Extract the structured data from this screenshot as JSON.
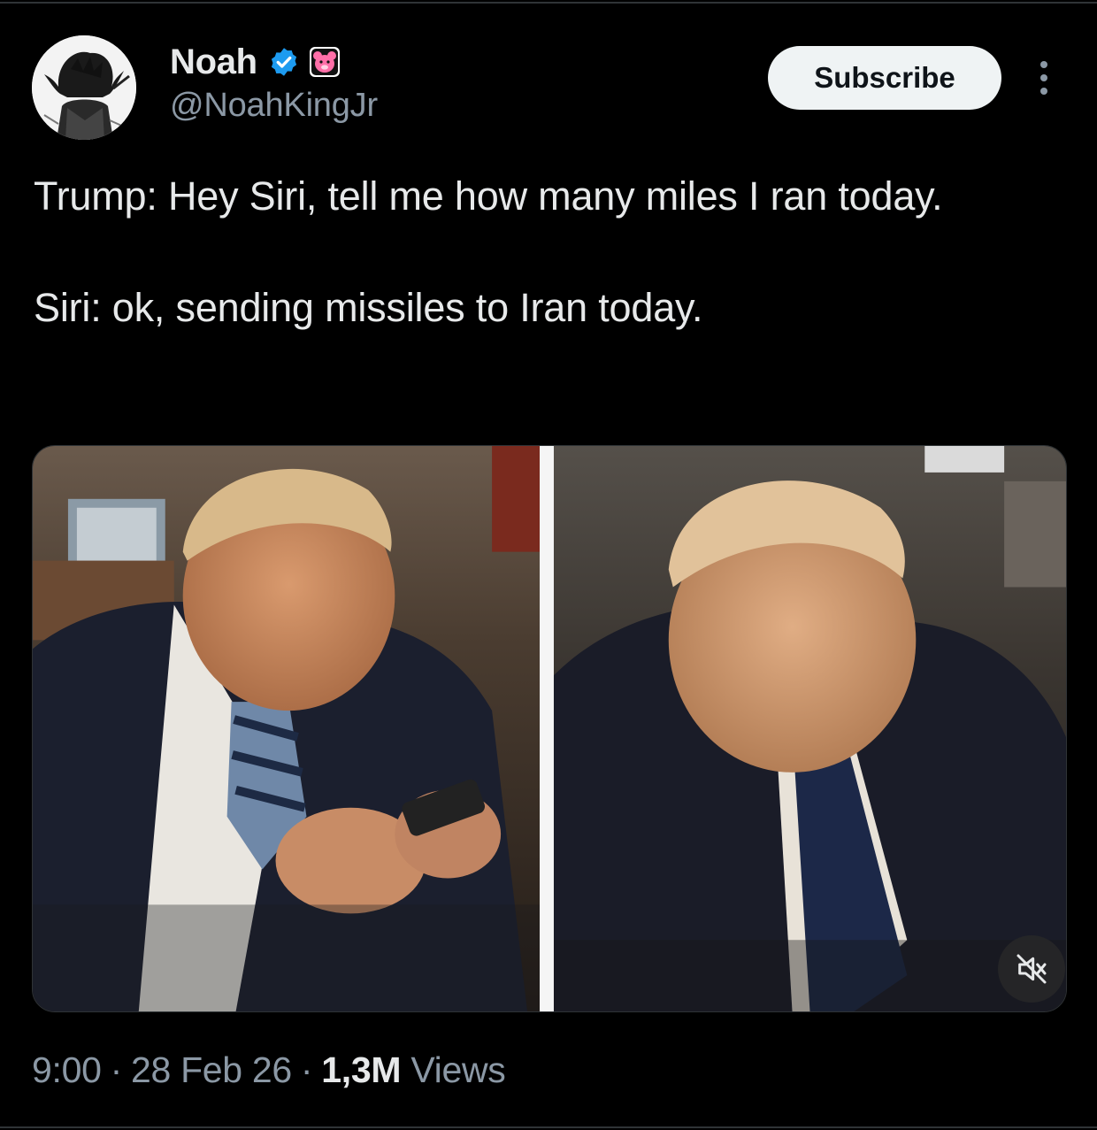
{
  "author": {
    "display_name": "Noah",
    "handle": "@NoahKingJr",
    "avatar_icon": "avatar-anime-character",
    "verified_icon": "verified-badge-icon",
    "affiliate_icon": "pink-bear-badge-icon",
    "verified_color": "#1d9bf0"
  },
  "actions": {
    "subscribe_label": "Subscribe",
    "more_icon": "more-vertical-icon"
  },
  "tweet": {
    "line_1": "Trump: Hey Siri, tell me how many miles I ran today.",
    "line_2": "Siri: ok, sending missiles to Iran today."
  },
  "media": {
    "type": "video",
    "mute_icon": "muted-speaker-icon"
  },
  "meta": {
    "time": "9:00",
    "date": "28 Feb 26",
    "views_count": "1,3M",
    "views_label": "Views",
    "separator": "·"
  }
}
